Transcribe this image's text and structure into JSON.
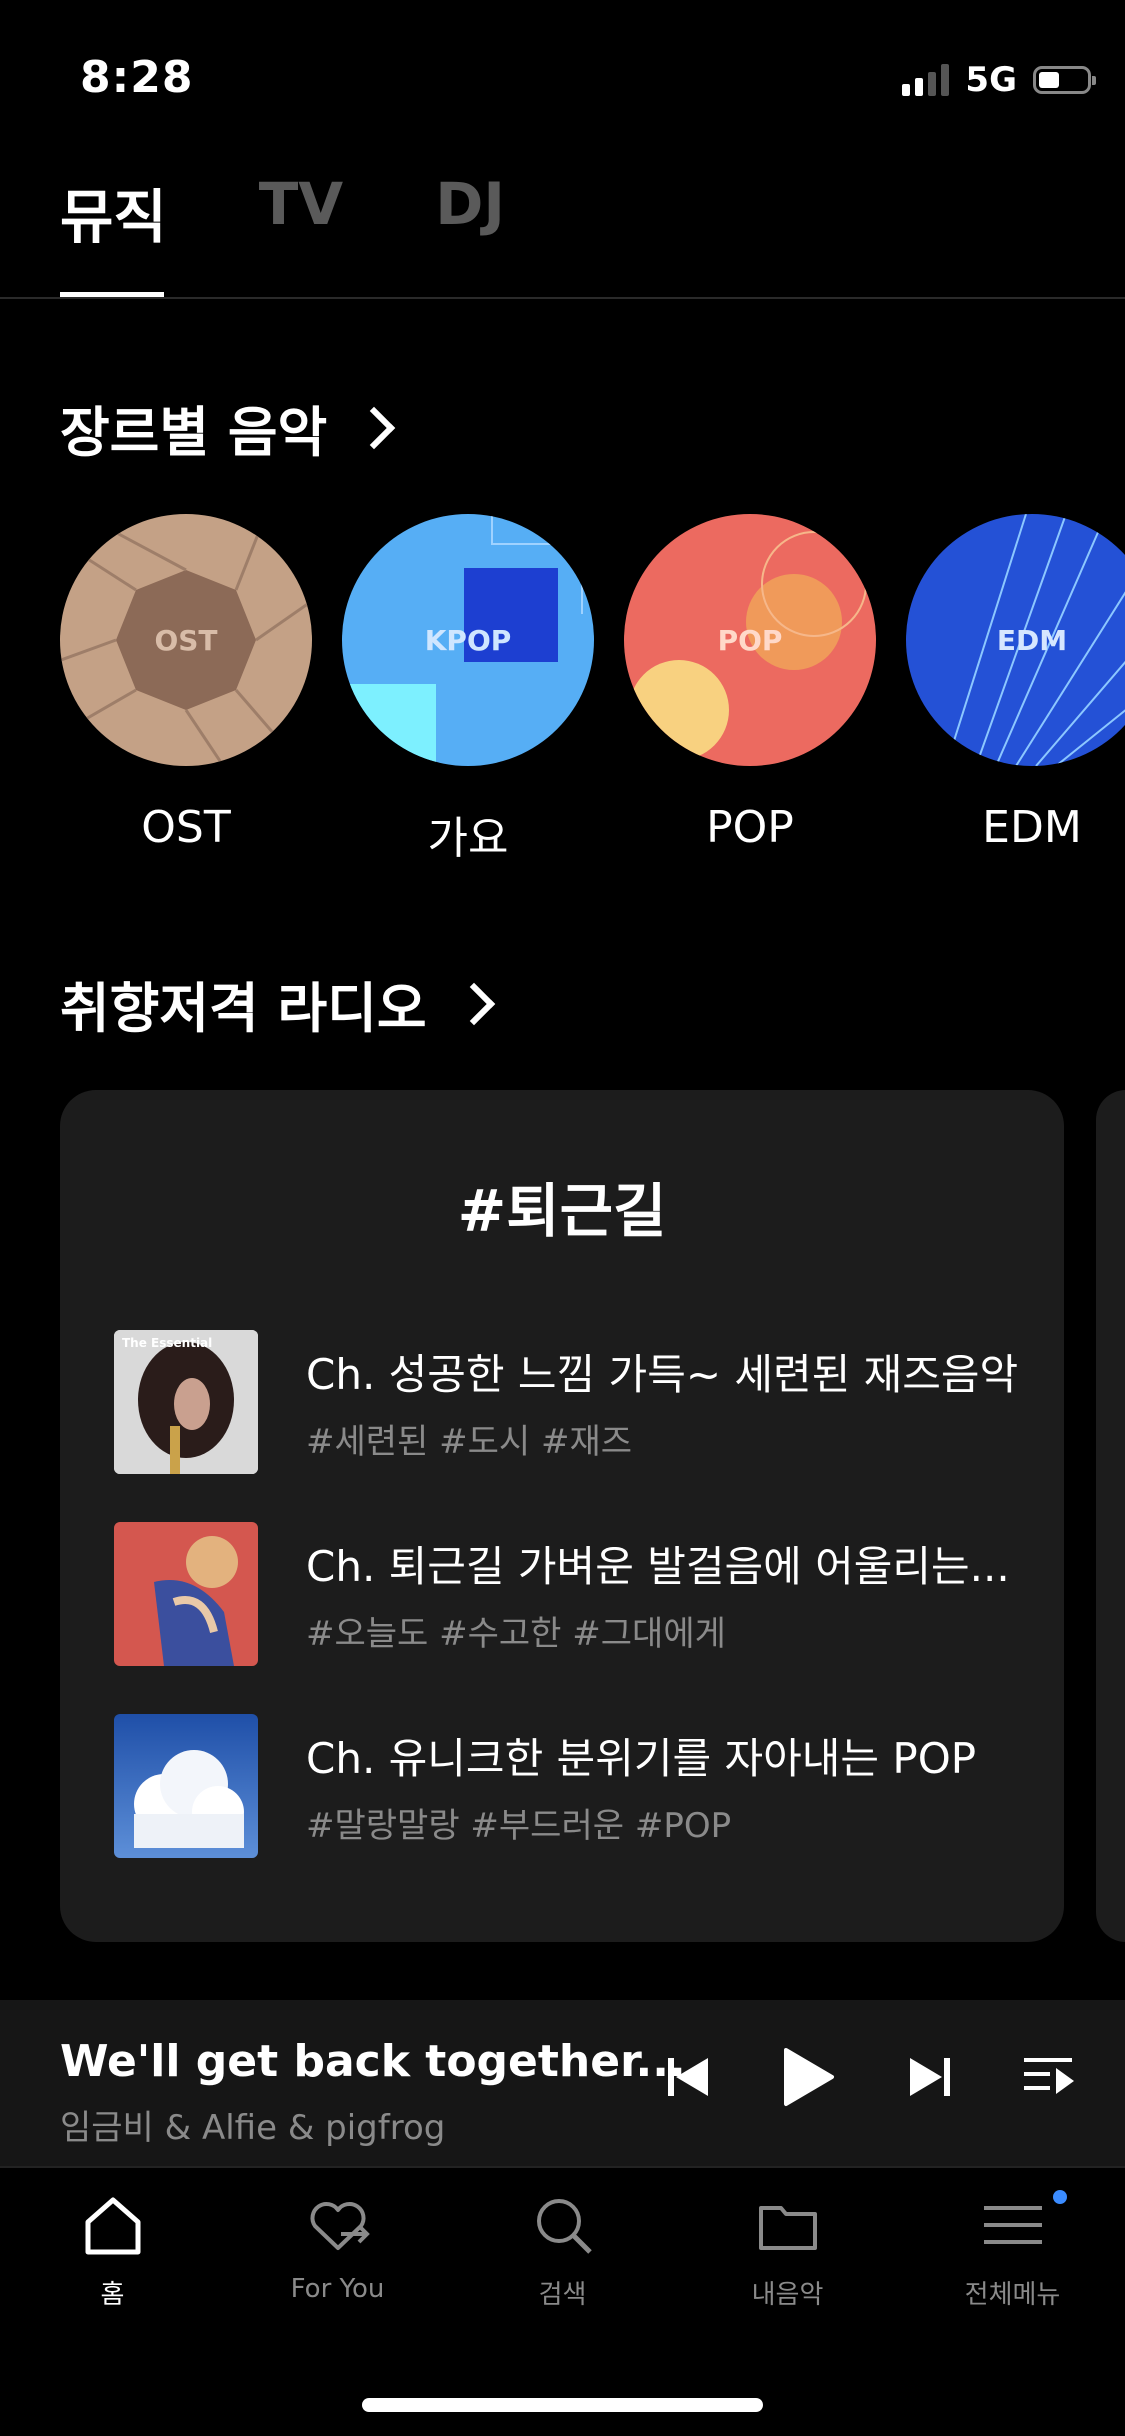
{
  "status": {
    "time": "8:28",
    "network": "5G"
  },
  "tabs": [
    {
      "label": "뮤직",
      "active": true
    },
    {
      "label": "TV",
      "active": false
    },
    {
      "label": "DJ",
      "active": false
    }
  ],
  "genre_section": {
    "title": "장르별 음악",
    "items": [
      {
        "label": "OST",
        "badge": "OST",
        "color": "#c4a186"
      },
      {
        "label": "가요",
        "badge": "KPOP",
        "color": "#56aef5"
      },
      {
        "label": "POP",
        "badge": "POP",
        "color": "#ec6a60"
      },
      {
        "label": "EDM",
        "badge": "EDM",
        "color": "#2451d6"
      }
    ]
  },
  "radio_section": {
    "title": "취향저격 라디오",
    "card": {
      "title": "#퇴근길",
      "channels": [
        {
          "title": "Ch. 성공한 느낌 가득~ 세련된 재즈음악",
          "tags": "#세련된 #도시 #재즈",
          "cover_text": "The Essential"
        },
        {
          "title": "Ch. 퇴근길 가벼운 발걸음에 어울리는...",
          "tags": "#오늘도 #수고한 #그대에게"
        },
        {
          "title": "Ch. 유니크한 분위기를 자아내는 POP",
          "tags": "#말랑말랑 #부드러운 #POP"
        }
      ]
    }
  },
  "player": {
    "title": "We'll get back together...",
    "artist": "임금비 & Alfie & pigfrog",
    "controls": [
      "previous-icon",
      "play-icon",
      "next-icon",
      "playlist-icon"
    ]
  },
  "bottom_nav": [
    {
      "label": "홈",
      "icon": "home-icon",
      "active": true
    },
    {
      "label": "For You",
      "icon": "heart-arrow-icon",
      "active": false
    },
    {
      "label": "검색",
      "icon": "search-icon",
      "active": false
    },
    {
      "label": "내음악",
      "icon": "folder-icon",
      "active": false
    },
    {
      "label": "전체메뉴",
      "icon": "menu-icon",
      "active": false,
      "notification_dot": true
    }
  ],
  "colors": {
    "background": "#000000",
    "card": "#1c1c1c",
    "muted_text": "#8a8a8a",
    "accent_dot": "#3b8cff"
  }
}
